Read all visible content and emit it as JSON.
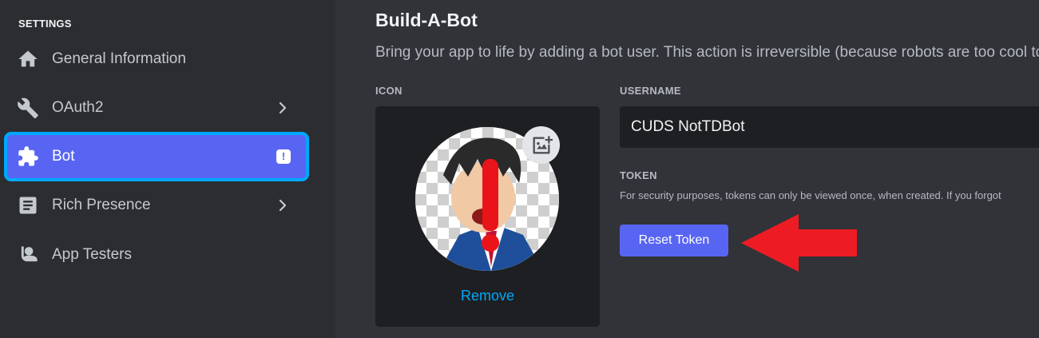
{
  "sidebar": {
    "section_title": "SETTINGS",
    "items": [
      {
        "label": "General Information",
        "icon": "home-icon",
        "has_chevron": false
      },
      {
        "label": "OAuth2",
        "icon": "wrench-icon",
        "has_chevron": true
      },
      {
        "label": "Bot",
        "icon": "puzzle-icon",
        "active": true,
        "badge": "!"
      },
      {
        "label": "Rich Presence",
        "icon": "document-icon",
        "has_chevron": true
      },
      {
        "label": "App Testers",
        "icon": "user-icon",
        "has_chevron": false
      }
    ]
  },
  "main": {
    "title": "Build-A-Bot",
    "description": "Bring your app to life by adding a bot user. This action is irreversible (because robots are too cool to",
    "icon_label": "ICON",
    "remove_label": "Remove",
    "username_label": "USERNAME",
    "username_value": "CUDS NotTDBot",
    "token_label": "TOKEN",
    "token_help": "For security purposes, tokens can only be viewed once, when created. If you forgot",
    "reset_label": "Reset Token"
  },
  "colors": {
    "accent": "#5865f2",
    "active_outline": "#00a8fc",
    "link": "#00a8fc",
    "annotation_arrow": "#ed1c24",
    "sidebar_bg": "#2b2d31",
    "main_bg": "#313338"
  }
}
